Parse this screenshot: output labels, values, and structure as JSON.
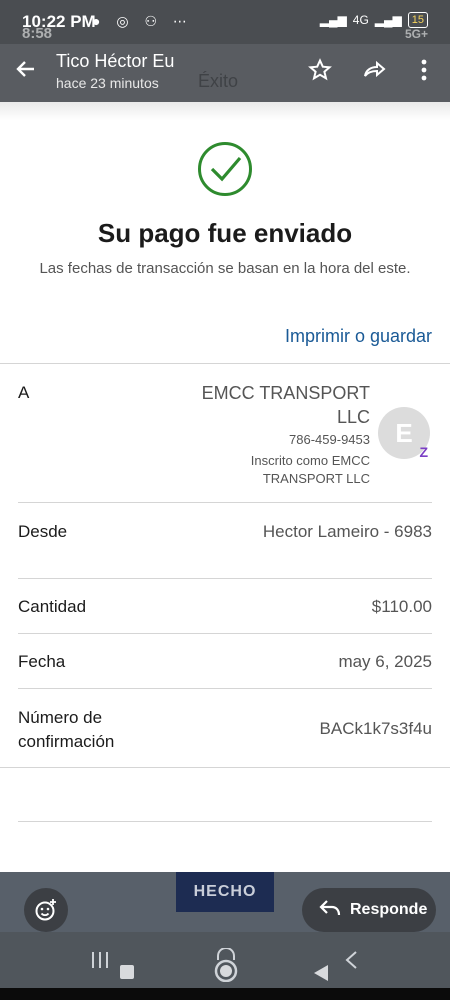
{
  "status_bar": {
    "time": "10:22 PM",
    "time_behind": "8:58",
    "network": "4G",
    "battery": "15",
    "network_behind": "5G+"
  },
  "chat_header": {
    "contact_name": "Tico Héctor Eu",
    "last_seen": "hace 23 minutos",
    "underlying_title": "Éxito"
  },
  "confirmation": {
    "title": "Su pago fue enviado",
    "subtitle": "Las fechas de transacción se basan en la hora del este.",
    "print_link": "Imprimir o guardar",
    "success_color": "#2e8b2e"
  },
  "details": {
    "to_label": "A",
    "recipient_name": "EMCC TRANSPORT LLC",
    "recipient_phone": "786-459-9453",
    "recipient_enrolled": "Inscrito como EMCC TRANSPORT LLC",
    "avatar_initial": "E",
    "avatar_badge": "Z",
    "from_label": "Desde",
    "from_value": "Hector Lameiro - 6983",
    "amount_label": "Cantidad",
    "amount_value": "$110.00",
    "date_label": "Fecha",
    "date_value": "may 6, 2025",
    "confirmation_label": "Número de confirmación",
    "confirmation_value": "BACk1k7s3f4u"
  },
  "actions": {
    "done_label": "HECHO",
    "reply_label": "Responde"
  },
  "icons": {
    "back": "arrow-left-icon",
    "star": "star-icon",
    "forward": "forward-icon",
    "more": "more-vert-icon",
    "success": "check-circle-icon",
    "emoji": "emoji-add-icon",
    "reply": "reply-icon"
  }
}
